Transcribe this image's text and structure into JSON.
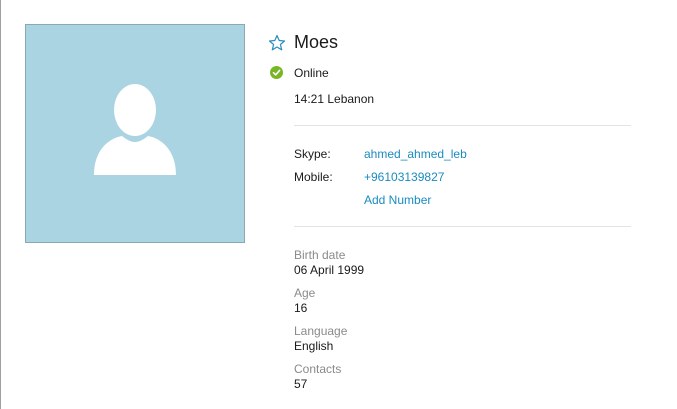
{
  "profile": {
    "name": "Moes",
    "status": "Online",
    "local_time": "14:21 Lebanon",
    "colors": {
      "avatar_bg": "#abd4e2",
      "online": "#7ab526",
      "link": "#1a8bbf",
      "label_muted": "#8a8a8a"
    },
    "icons": {
      "favorite": "star-outline-icon",
      "status": "online-check-icon",
      "avatar": "default-user-silhouette"
    }
  },
  "contact": {
    "skype_label": "Skype:",
    "skype_value": "ahmed_ahmed_leb",
    "mobile_label": "Mobile:",
    "mobile_value": "+96103139827",
    "add_number": "Add Number"
  },
  "details": [
    {
      "label": "Birth date",
      "value": "06 April 1999"
    },
    {
      "label": "Age",
      "value": "16"
    },
    {
      "label": "Language",
      "value": "English"
    },
    {
      "label": "Contacts",
      "value": "57"
    }
  ]
}
